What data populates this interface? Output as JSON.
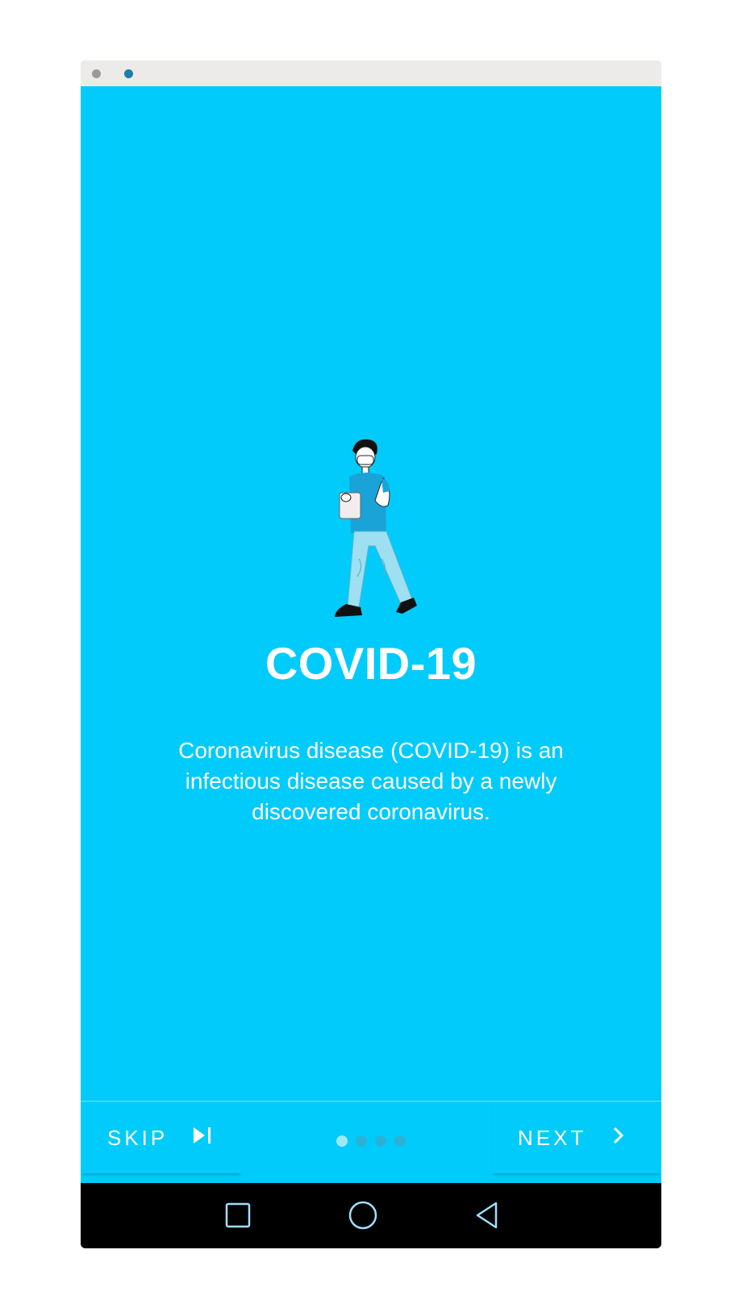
{
  "window": {
    "close_icon": "close-dot",
    "min_icon": "minimize-dot"
  },
  "onboarding": {
    "illustration": "doctor-with-clipboard",
    "title": "COVID-19",
    "description": "Coronavirus disease (COVID-19) is an infectious disease caused by a newly discovered coronavirus.",
    "page_index": 1,
    "page_count": 4
  },
  "footer": {
    "skip_label": "SKIP",
    "skip_icon": "skip-next-icon",
    "next_label": "NEXT",
    "next_icon": "chevron-right-icon"
  },
  "navbar": {
    "recents_icon": "square",
    "home_icon": "circle",
    "back_icon": "triangle"
  },
  "colors": {
    "background": "#00cbfb",
    "text": "#ffffff",
    "active_dot": "#9fe8ff",
    "inactive_dot": "#2ab2d6",
    "navbar": "#000000"
  }
}
